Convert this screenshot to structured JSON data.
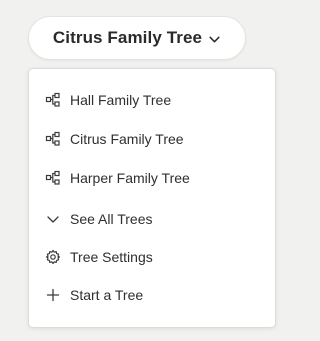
{
  "current_tree": {
    "label": "Citrus Family Tree"
  },
  "menu": {
    "items": [
      {
        "label": "Hall Family Tree",
        "icon": "tree-icon"
      },
      {
        "label": "Citrus Family Tree",
        "icon": "tree-icon"
      },
      {
        "label": "Harper Family Tree",
        "icon": "tree-icon"
      },
      {
        "label": "See All Trees",
        "icon": "chevron-down-icon"
      },
      {
        "label": "Tree Settings",
        "icon": "gear-icon"
      },
      {
        "label": "Start a Tree",
        "icon": "plus-icon"
      }
    ]
  },
  "colors": {
    "background": "#f1f1ef",
    "surface": "#ffffff",
    "text": "#2f2f2d"
  }
}
